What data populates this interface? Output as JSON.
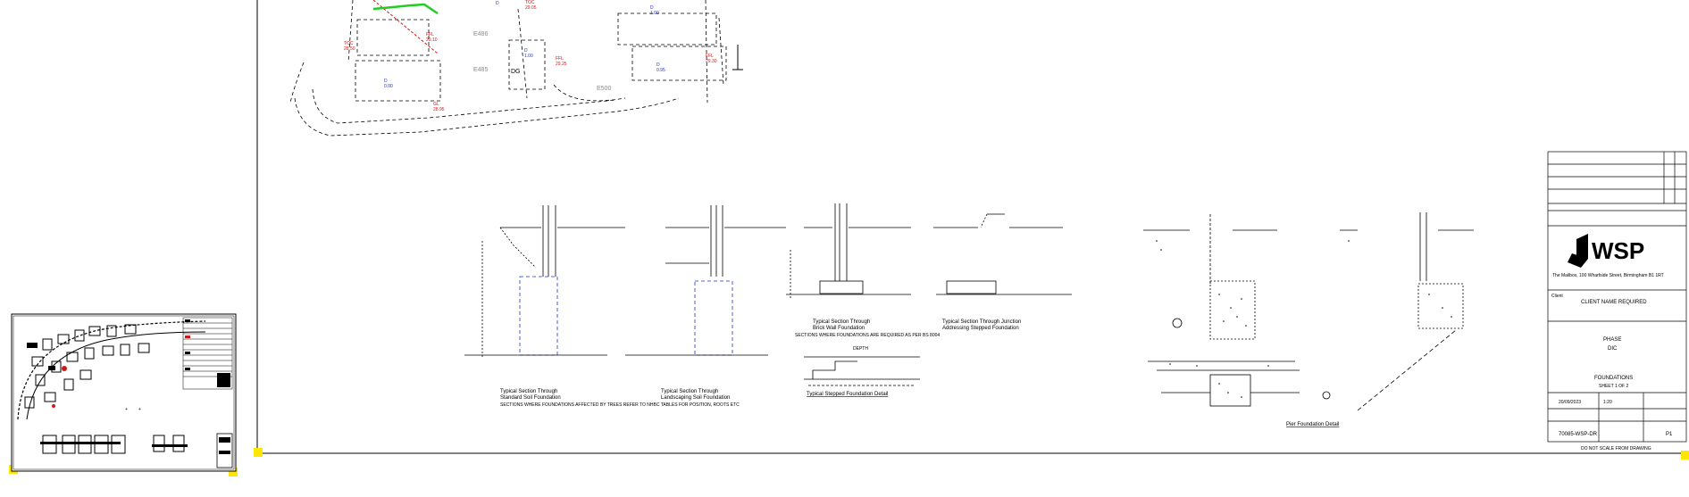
{
  "canvas": {
    "background": "#ffffff"
  },
  "thumbnail": {
    "label": "Drawing sheet preview"
  },
  "site_plan": {
    "plot_labels": [
      "E486",
      "E485",
      "E500",
      "DG"
    ],
    "colors": {
      "dimension_text": "#2233cc",
      "level_text": "#d01818",
      "boundary_highlight": "#22cc22"
    }
  },
  "details": [
    {
      "caption_line1": "Typical Section Through",
      "caption_line2": "Standard Soil Foundation"
    },
    {
      "caption_line1": "Typical Section Through",
      "caption_line2": "Landscaping Soil Foundation"
    },
    {
      "caption_line1": "Typical Section Through",
      "caption_line2": "Brick Wall Foundation"
    },
    {
      "caption_line1": "Typical Section Through Junction",
      "caption_line2": "Addressing Stepped Foundation"
    }
  ],
  "notes": {
    "note_a": "SECTIONS WHERE FOUNDATIONS AFFECTED BY TREES REFER TO NHBC TABLES FOR POSITION, ROOTS ETC",
    "note_b": "SECTIONS WHERE FOUNDATIONS ARE REQUIRED AS PER BS 8004",
    "note_c": "DEPTH",
    "stepped_title": "Typical Stepped Foundation Detail",
    "pier_title": "Pier Foundation Detail"
  },
  "title_block": {
    "company": "WSP",
    "address": "The Mailbox, 100 Wharfside Street, Birmingham B1 1RT",
    "drawing_type": "CLIENT NAME REQUIRED",
    "client_label": "Client",
    "project_line1": "PHASE",
    "project_line2": "DIC",
    "drawing_title": "FOUNDATIONS",
    "drawing_subtitle": "SHEET 1 OF 2",
    "scale": "1:20",
    "date": "20/09/2023",
    "drawing_no": "70085-WSP-DR",
    "revision": "P1",
    "footer": "DO NOT SCALE FROM DRAWING"
  }
}
